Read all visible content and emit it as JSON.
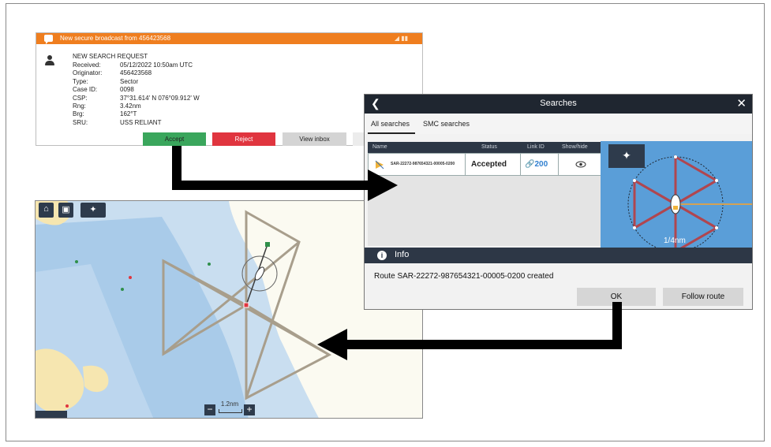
{
  "broadcast": {
    "header": "New secure broadcast from 456423568",
    "title": "NEW SEARCH REQUEST",
    "rows": [
      {
        "key": "Received:",
        "value": "05/12/2022 10:50am UTC"
      },
      {
        "key": "Originator:",
        "value": "456423568"
      },
      {
        "key": "Type:",
        "value": "Sector"
      },
      {
        "key": "Case ID:",
        "value": "0098"
      },
      {
        "key": "CSP:",
        "value": "37°31.614' N 076°09.912' W"
      },
      {
        "key": "Rng:",
        "value": "3.42nm"
      },
      {
        "key": "Brg:",
        "value": "162°T"
      },
      {
        "key": "SRU:",
        "value": "USS RELIANT"
      }
    ],
    "buttons": {
      "accept": "Accept",
      "reject": "Reject",
      "view_inbox": "View inbox"
    }
  },
  "chart_map": {
    "scale": "1.2nm",
    "zoom_out": "−",
    "zoom_in": "+",
    "icons": [
      "home-icon",
      "save-icon",
      "sar-icon"
    ],
    "colors": {
      "land": "#fbfaf1",
      "shallow": "#a9cbe9",
      "deep": "#c9def0",
      "route": "#a89e8c"
    }
  },
  "searches": {
    "title": "Searches",
    "tabs": [
      "All searches",
      "SMC searches"
    ],
    "columns": [
      "Name",
      "Status",
      "Link ID",
      "Show/hide"
    ],
    "row": {
      "name": "SAR-22272-987654321-00005-0200",
      "status": "Accepted",
      "link_id": "200"
    },
    "pattern_range": "1/4nm",
    "info_label": "Info",
    "message": "Route SAR-22272-987654321-00005-0200 created",
    "ok": "OK",
    "follow": "Follow route"
  }
}
